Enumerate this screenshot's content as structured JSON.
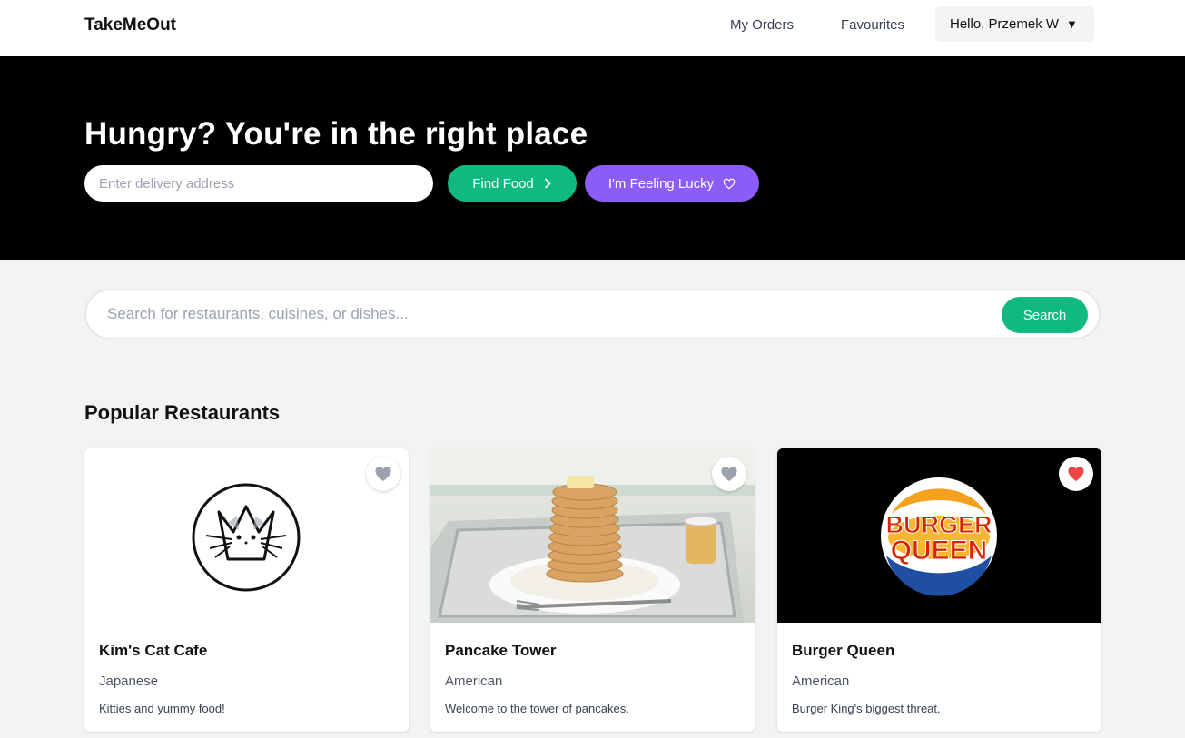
{
  "header": {
    "brand": "TakeMeOut",
    "nav": {
      "orders": "My Orders",
      "favourites": "Favourites"
    },
    "user_menu": {
      "label": "Hello, Przemek W",
      "caret": "▼"
    }
  },
  "hero": {
    "title": "Hungry? You're in the right place",
    "address_placeholder": "Enter delivery address",
    "find_label": "Find Food",
    "lucky_label": "I'm Feeling Lucky",
    "find_icon": "chevron-right-icon",
    "lucky_icon": "heart-outline-icon"
  },
  "search": {
    "placeholder": "Search for restaurants, cuisines, or dishes...",
    "button_label": "Search"
  },
  "popular": {
    "title": "Popular Restaurants",
    "restaurants": [
      {
        "name": "Kim's Cat Cafe",
        "cuisine": "Japanese",
        "description": "Kitties and yummy food!",
        "favourite": false,
        "image": "cat-logo-image"
      },
      {
        "name": "Pancake Tower",
        "cuisine": "American",
        "description": "Welcome to the tower of pancakes.",
        "favourite": false,
        "image": "pancake-stack-photo"
      },
      {
        "name": "Burger Queen",
        "cuisine": "American",
        "description": "Burger King's biggest threat.",
        "favourite": true,
        "image": "burger-queen-logo",
        "logo_text": [
          "BURGER",
          "QUEEN"
        ]
      }
    ]
  },
  "colors": {
    "accent_green": "#10b981",
    "accent_purple": "#8b5cf6",
    "heart_active": "#ef4444",
    "heart_inactive": "#9ca3af"
  }
}
